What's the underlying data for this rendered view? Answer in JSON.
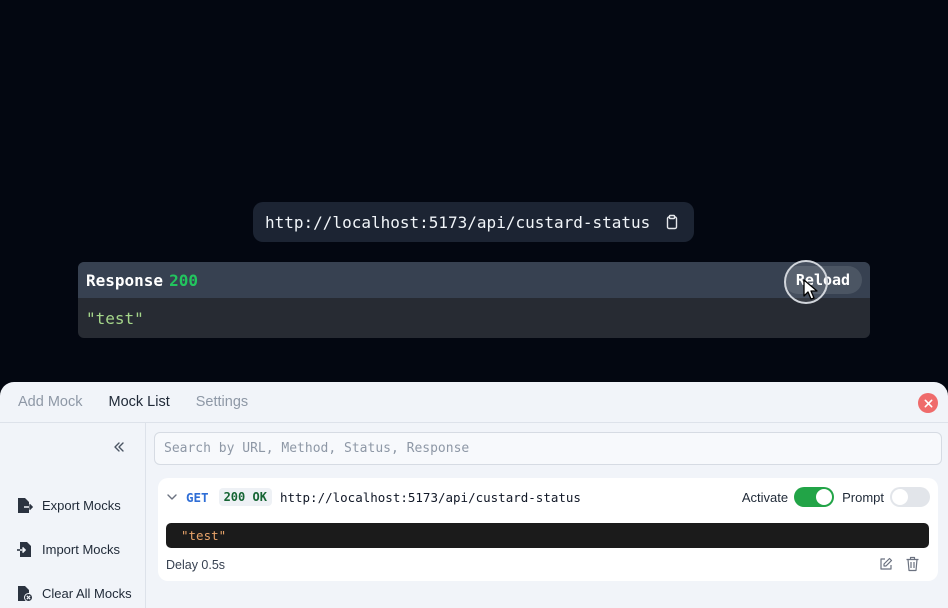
{
  "app": {
    "url": "http://localhost:5173/api/custard-status",
    "response_label": "Response",
    "response_status": "200",
    "reload_label": "Reload",
    "response_body": "\"test\""
  },
  "panel": {
    "tabs": [
      {
        "label": "Add Mock",
        "active": false
      },
      {
        "label": "Mock List",
        "active": true
      },
      {
        "label": "Settings",
        "active": false
      }
    ],
    "sidebar": {
      "items": [
        {
          "label": "Export Mocks",
          "icon": "export-file-icon"
        },
        {
          "label": "Import Mocks",
          "icon": "import-file-icon"
        },
        {
          "label": "Clear All Mocks",
          "icon": "clear-file-icon"
        }
      ]
    },
    "search": {
      "placeholder": "Search by URL, Method, Status, Response",
      "value": ""
    },
    "mocks": [
      {
        "method": "GET",
        "status": "200 OK",
        "url": "http://localhost:5173/api/custard-status",
        "activate_label": "Activate",
        "activate_on": true,
        "prompt_label": "Prompt",
        "prompt_on": false,
        "response": "\"test\"",
        "delay": "Delay 0.5s"
      }
    ]
  },
  "colors": {
    "background": "#030711",
    "status_ok": "#22c55e",
    "method": "#2f6ed6",
    "toggle_on": "#22a447",
    "close": "#ef6b6b"
  }
}
